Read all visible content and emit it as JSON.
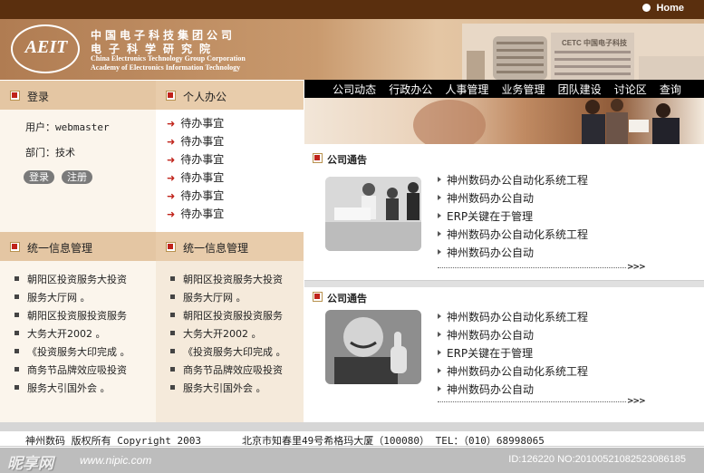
{
  "topbar": {
    "home_label": "Home"
  },
  "header": {
    "logo_text": "AEIT",
    "name_cn_1": "中国电子科技集团公司",
    "name_cn_2": "电子科学研究院",
    "name_en_1": "China Electronics Technology Group Corporation",
    "name_en_2": "Academy of Electronics Information Technology",
    "building_sign": "CETC 中国电子科技"
  },
  "nav": {
    "items": [
      "公司动态",
      "行政办公",
      "人事管理",
      "业务管理",
      "团队建设",
      "讨论区",
      "查询"
    ]
  },
  "login": {
    "title": "登录",
    "user_label": "用户：webmaster",
    "dept_label": "部门：技术",
    "login_button": "登录",
    "register_button": "注册"
  },
  "office": {
    "title": "个人办公",
    "items": [
      "待办事宜",
      "待办事宜",
      "待办事宜",
      "待办事宜",
      "待办事宜",
      "待办事宜"
    ]
  },
  "info_left": {
    "title": "统一信息管理",
    "items": [
      "朝阳区投资服务大投资",
      "服务大厅网 。",
      "朝阳区投资服投资服务",
      "大务大开2002 。",
      "《投资服务大印完成 。",
      "商务节品牌效应吸投资",
      "服务大引国外会 。"
    ]
  },
  "info_right": {
    "title": "统一信息管理",
    "items": [
      "朝阳区投资服务大投资",
      "服务大厅网 。",
      "朝阳区投资服投资服务",
      "大务大开2002 。",
      "《投资服务大印完成 。",
      "商务节品牌效应吸投资",
      "服务大引国外会 。"
    ]
  },
  "notice1": {
    "title": "公司通告",
    "items": [
      "神州数码办公自动化系统工程",
      "神州数码办公自动",
      "ERP关键在于管理",
      "神州数码办公自动化系统工程",
      "神州数码办公自动"
    ],
    "more": ">>>"
  },
  "notice2": {
    "title": "公司通告",
    "items": [
      "神州数码办公自动化系统工程",
      "神州数码办公自动",
      "ERP关键在于管理",
      "神州数码办公自动化系统工程",
      "神州数码办公自动"
    ],
    "more": ">>>"
  },
  "footer": {
    "copyright": "神州数码 版权所有 Copyright 2003",
    "address": "北京市知春里49号希格玛大厦（100080） TEL：（010）68998065"
  },
  "watermark": {
    "site": "昵享网",
    "url": "www.nipic.com",
    "id_text": "ID:126220 NO:20100521082523086185"
  },
  "colors": {
    "accent_red": "#c0231a",
    "brown_bar": "#5a2f0e",
    "panel_beige": "#e4c6a3"
  }
}
